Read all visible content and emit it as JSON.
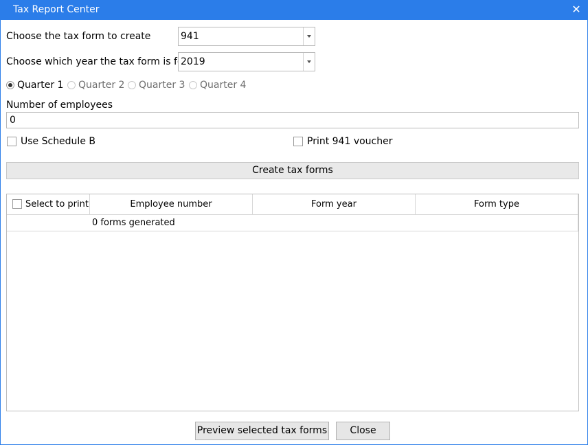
{
  "window": {
    "title": "Tax Report Center",
    "close_glyph": "✕"
  },
  "form": {
    "tax_form_label": "Choose the tax form to create",
    "tax_form_value": "941",
    "year_label": "Choose which year the tax form is for",
    "year_value": "2019",
    "quarters": [
      {
        "label": "Quarter 1",
        "selected": true
      },
      {
        "label": "Quarter 2",
        "selected": false
      },
      {
        "label": "Quarter 3",
        "selected": false
      },
      {
        "label": "Quarter 4",
        "selected": false
      }
    ],
    "employees_label": "Number of employees",
    "employees_value": "0",
    "schedule_b_label": "Use Schedule B",
    "schedule_b_checked": false,
    "voucher_label": "Print 941 voucher",
    "voucher_checked": false,
    "create_button": "Create tax forms"
  },
  "grid": {
    "columns": [
      "Select to print",
      "Employee number",
      "Form year",
      "Form type"
    ],
    "status_row": "0 forms generated"
  },
  "footer": {
    "preview_button": "Preview selected tax forms",
    "close_button": "Close"
  },
  "colors": {
    "titlebar": "#2b7de9"
  }
}
